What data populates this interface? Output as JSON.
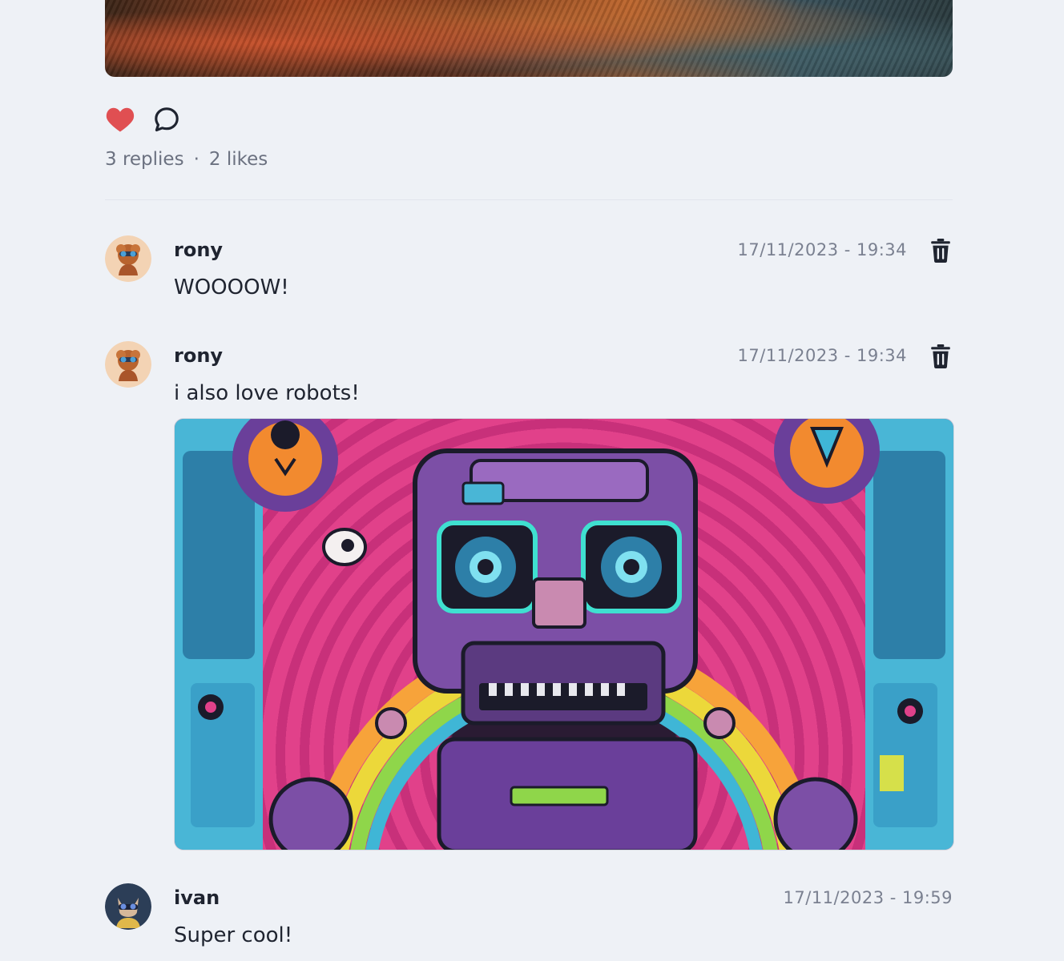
{
  "post": {
    "reply_count": "3 replies",
    "separator": "·",
    "like_count": "2 likes",
    "icons": {
      "like": "heart-icon",
      "reply": "comment-bubble-icon"
    },
    "colors": {
      "like": "#e04f52",
      "text_muted": "#6b7180"
    }
  },
  "comments": [
    {
      "author": "rony",
      "timestamp": "17/11/2023 - 19:34",
      "text": "WOOOOW!",
      "has_image": false,
      "deletable": true
    },
    {
      "author": "rony",
      "timestamp": "17/11/2023 - 19:34",
      "text": "i also love robots!",
      "has_image": true,
      "deletable": true
    },
    {
      "author": "ivan",
      "timestamp": "17/11/2023 - 19:59",
      "text": "Super cool!",
      "has_image": false,
      "deletable": false
    }
  ]
}
